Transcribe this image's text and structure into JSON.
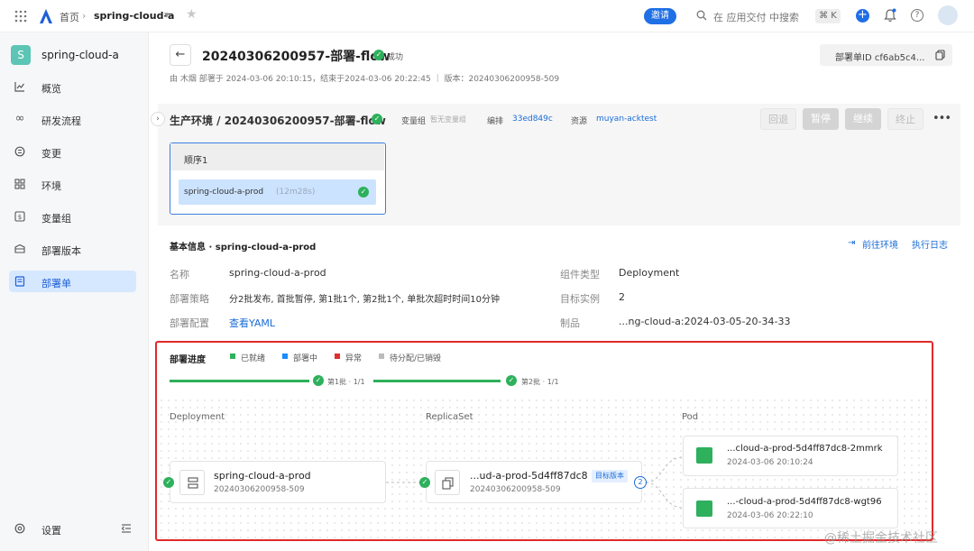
{
  "topbar": {
    "home": "首页",
    "app_name": "spring-cloud-a",
    "invite": "邀请",
    "search_placeholder": "在 应用交付 中搜索",
    "shortcut": "⌘ K"
  },
  "sidebar": {
    "app_initial": "S",
    "app_name": "spring-cloud-a",
    "items": [
      {
        "label": "概览",
        "icon": "chart-line-icon"
      },
      {
        "label": "研发流程",
        "icon": "infinity-icon"
      },
      {
        "label": "变更",
        "icon": "change-icon"
      },
      {
        "label": "环境",
        "icon": "grid-icon"
      },
      {
        "label": "变量组",
        "icon": "variable-icon"
      },
      {
        "label": "部署版本",
        "icon": "package-icon"
      },
      {
        "label": "部署单",
        "icon": "document-icon",
        "active": true
      }
    ],
    "settings": "设置"
  },
  "header": {
    "title": "20240306200957-部署-flow",
    "status": "成功",
    "meta": "由 木烟 部署于 2024-03-06 20:10:15，结束于2024-03-06 20:22:45 ｜ 版本：20240306200958-509",
    "deploy_id": "部署单ID cf6ab5c4..."
  },
  "stage": {
    "title": "生产环境 / 20240306200957-部署-flow",
    "var_group_label": "变量组",
    "var_group_value": "暂无变量组",
    "orch_label": "编排",
    "orch_value": "33ed849c",
    "resource_label": "资源",
    "resource_value": "muyan-acktest",
    "actions": {
      "rollback": "回退",
      "pause": "暂停",
      "continue": "继续",
      "stop": "终止"
    },
    "sequence_title": "顺序1",
    "job_name": "spring-cloud-a-prod",
    "job_duration": "(12m28s)"
  },
  "info": {
    "title": "基本信息 · spring-cloud-a-prod",
    "goto_env": "前往环境",
    "exec_log": "执行日志",
    "name_k": "名称",
    "name_v": "spring-cloud-a-prod",
    "strategy_k": "部署策略",
    "strategy_v": "分2批发布, 首批暂停, 第1批1个, 第2批1个, 单批次超时时间10分钟",
    "config_k": "部署配置",
    "config_v": "查看YAML",
    "type_k": "组件类型",
    "type_v": "Deployment",
    "instances_k": "目标实例",
    "instances_v": "2",
    "artifact_k": "制品",
    "artifact_v": "...ng-cloud-a:2024-03-05-20-34-33"
  },
  "progress": {
    "title": "部署进度",
    "legend": [
      {
        "label": "已就绪",
        "color": "#2eb05c"
      },
      {
        "label": "部署中",
        "color": "#1a8cff"
      },
      {
        "label": "异常",
        "color": "#e0302b"
      },
      {
        "label": "待分配/已销毁",
        "color": "#bbbbbb"
      }
    ],
    "batch1": "第1批 · 1/1",
    "batch2": "第2批 · 1/1",
    "col_deployment": "Deployment",
    "col_replicaset": "ReplicaSet",
    "col_pod": "Pod",
    "deployment": {
      "name": "spring-cloud-a-prod",
      "version": "20240306200958-509"
    },
    "replicaset": {
      "name": "...ud-a-prod-5d4ff87dc8",
      "version": "20240306200958-509",
      "tag": "目标版本",
      "count": "2"
    },
    "pods": [
      {
        "name": "...cloud-a-prod-5d4ff87dc8-2mmrk",
        "time": "2024-03-06 20:10:24"
      },
      {
        "name": "...-cloud-a-prod-5d4ff87dc8-wgt96",
        "time": "2024-03-06 20:22:10"
      }
    ]
  },
  "watermark": "@稀土掘金技术社区"
}
